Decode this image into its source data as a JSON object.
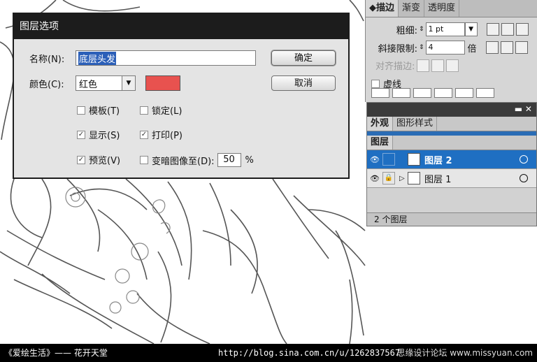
{
  "dialog": {
    "title": "图层选项",
    "name_label": "名称(N):",
    "name_value": "底层头发",
    "color_label": "颜色(C):",
    "color_value": "红色",
    "swatch_color": "#e8524f",
    "ok_label": "确定",
    "cancel_label": "取消",
    "template_label": "模板(T)",
    "template_checked": false,
    "lock_label": "锁定(L)",
    "lock_checked": false,
    "show_label": "显示(S)",
    "show_checked": true,
    "print_label": "打印(P)",
    "print_checked": true,
    "preview_label": "预览(V)",
    "preview_checked": true,
    "dim_label": "变暗图像至(D):",
    "dim_checked": false,
    "dim_value": "50",
    "dim_unit": "%"
  },
  "stroke_panel": {
    "tabs": [
      "描边",
      "渐变",
      "透明度"
    ],
    "weight_label": "粗细:",
    "weight_value": "1 pt",
    "miter_label": "斜接限制:",
    "miter_value": "4",
    "miter_unit": "倍",
    "align_label": "对齐描边:",
    "dashed_label": "虚线"
  },
  "layers_panel": {
    "tabs_top": [
      "外观",
      "图形样式"
    ],
    "tab_layers": "图层",
    "layers": [
      {
        "name": "图层 2",
        "selected": true
      },
      {
        "name": "图层 1",
        "selected": false
      }
    ],
    "footer": "2 个图层"
  },
  "bottom_bar": {
    "left": "《爱绘生活》—— 花开天堂",
    "url": "http://blog.sina.com.cn/u/1262837567",
    "right": "思缘设计论坛 www.missyuan.com"
  }
}
